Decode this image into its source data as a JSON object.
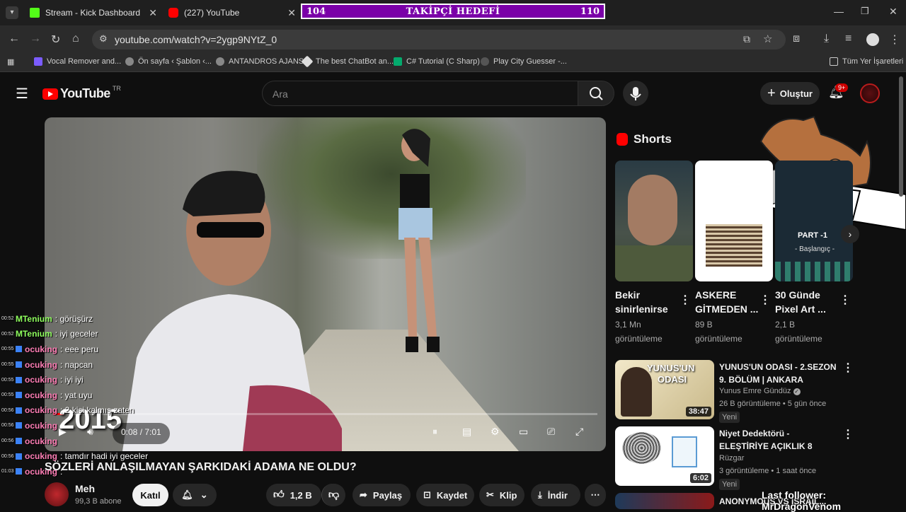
{
  "tabs": [
    {
      "label": "Stream - Kick Dashboard",
      "fav_color": "#53fc18"
    },
    {
      "label": "(227) YouTube",
      "fav_color": "#ff0000"
    }
  ],
  "goal": {
    "current": "104",
    "title": "TAKİPÇİ HEDEFİ",
    "target": "110"
  },
  "url": "youtube.com/watch?v=2ygp9NYtZ_0",
  "bookmarks": [
    {
      "label": "Vocal Remover and...",
      "color": "#7b5cff"
    },
    {
      "label": "Ön sayfa ‹ Şablon ‹...",
      "color": "#888"
    },
    {
      "label": "ANTANDROS AJANS",
      "color": "#888"
    },
    {
      "label": "The best ChatBot an...",
      "color": "#ddd"
    },
    {
      "label": "C# Tutorial (C Sharp)",
      "color": "#04aa6d"
    },
    {
      "label": "Play City Guesser -...",
      "color": "#555"
    }
  ],
  "all_bookmarks": "Tüm Yer İşaretleri",
  "yt": {
    "logo_text": "YouTube",
    "country": "TR",
    "search_placeholder": "Ara",
    "create_label": "Oluştur",
    "notif_count": "9+"
  },
  "player": {
    "time": "0:08 / 7:01",
    "overlay_text": "2015"
  },
  "chat": [
    {
      "ts": "00:52",
      "user": "MTenium",
      "color": "#8fff5e",
      "badge": false,
      "msg": ": görüşürz"
    },
    {
      "ts": "00:52",
      "user": "MTenium",
      "color": "#8fff5e",
      "badge": false,
      "msg": ": iyi geceler"
    },
    {
      "ts": "00:55",
      "user": "ocuking",
      "color": "#ff7eb6",
      "badge": true,
      "msg": ": eee peru"
    },
    {
      "ts": "00:55",
      "user": "ocuking",
      "color": "#ff7eb6",
      "badge": true,
      "msg": ": napcan"
    },
    {
      "ts": "00:55",
      "user": "ocuking",
      "color": "#ff7eb6",
      "badge": true,
      "msg": ": iyi iyi"
    },
    {
      "ts": "00:55",
      "user": "ocuking",
      "color": "#ff7eb6",
      "badge": true,
      "msg": ": yat uyu"
    },
    {
      "ts": "00:56",
      "user": "ocuking",
      "color": "#ff7eb6",
      "badge": true,
      "msg": ": 2 kişi kalmış zaten"
    },
    {
      "ts": "00:56",
      "user": "ocuking",
      "color": "#ff7eb6",
      "badge": true,
      "msg": ""
    },
    {
      "ts": "00:56",
      "user": "ocuking",
      "color": "#ff7eb6",
      "badge": true,
      "msg": ""
    },
    {
      "ts": "00:56",
      "user": "ocuking",
      "color": "#ff7eb6",
      "badge": true,
      "msg": ": tamdır hadi iyi geceler"
    },
    {
      "ts": "01:03",
      "user": "ocuking",
      "color": "#ff7eb6",
      "badge": true,
      "msg": ":"
    }
  ],
  "video": {
    "title": "SÖZLERİ ANLAŞILMAYAN ŞARKIDAKİ ADAMA NE OLDU?",
    "channel": "Meh",
    "subs": "99,3 B abone",
    "join": "Katıl",
    "likes": "1,2 B",
    "share": "Paylaş",
    "save": "Kaydet",
    "clip": "Klip",
    "download": "İndir"
  },
  "shorts": {
    "heading": "Shorts",
    "items": [
      {
        "title1": "Bekir",
        "title2": "sinirlenirse",
        "views1": "3,1 Mn",
        "views2": "görüntüleme"
      },
      {
        "title1": "ASKERE",
        "title2": "GİTMEDEN ...",
        "views1": "89 B",
        "views2": "görüntüleme"
      },
      {
        "title1": "30 Günde",
        "title2": "Pixel Art ...",
        "views1": "2,1 B",
        "views2": "görüntüleme",
        "thumb_text1": "PART -1",
        "thumb_text2": "- Başlangıç -"
      }
    ]
  },
  "recs": [
    {
      "title": "YUNUS'UN ODASI - 2.SEZON 9. BÖLÜM | ANKARA",
      "channel": "Yunus Emre Gündüz",
      "meta": "26 B görüntüleme • 5 gün önce",
      "duration": "38:47",
      "badge": "Yeni",
      "thumb_text1": "YUNUS'UN",
      "thumb_text2": "ODASI"
    },
    {
      "title": "Niyet Dedektörü -  ELEŞTİRİYE AÇIKLIK 8",
      "channel": "Rüzgar",
      "meta": "3 görüntüleme • 1 saat önce",
      "duration": "6:02",
      "badge": "Yeni"
    },
    {
      "title": "ANONYMOUS VS ISRAIL..."
    }
  ],
  "overlay": {
    "last_follower": "Last follower: MrDragonVenom"
  }
}
